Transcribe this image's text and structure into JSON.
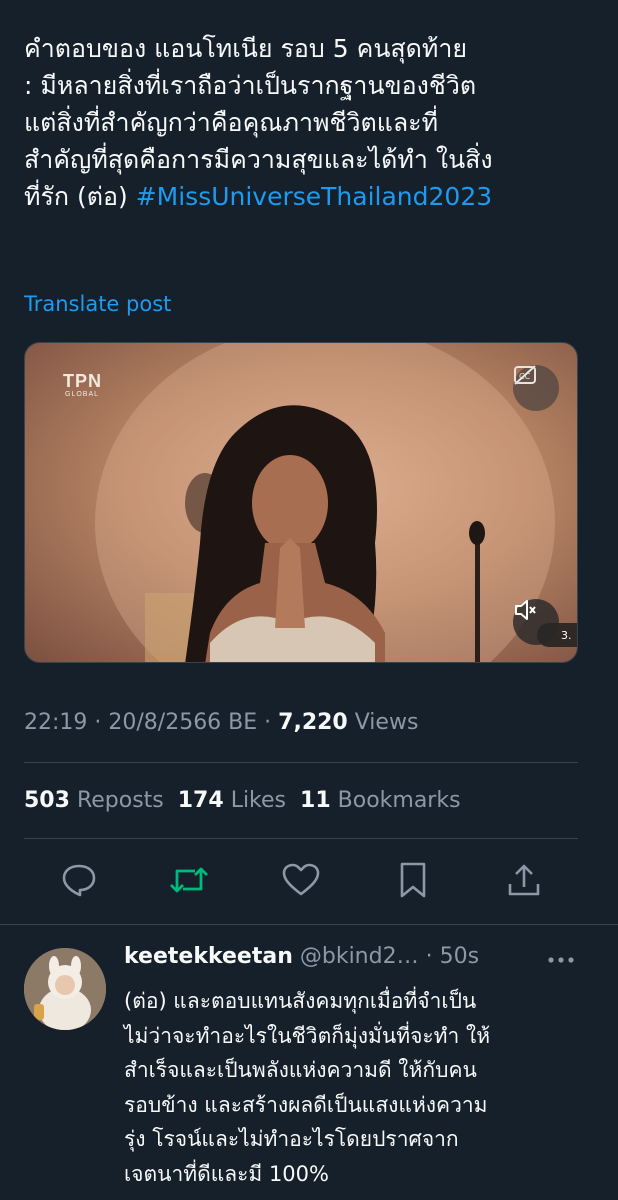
{
  "post": {
    "lines": [
      "คำตอบของ แอนโทเนีย รอบ 5 คนสุดท้าย",
      ": มีหลายสิ่งที่เราถือว่าเป็นรากฐานของชีวิต",
      "แต่สิ่งที่สำคัญกว่าคือคุณภาพชีวิตและที่",
      "สำคัญที่สุดคือการมีความสุขและได้ทำ ในสิ่ง"
    ],
    "last_line_prefix": "ที่รัก (ต่อ) ",
    "hashtag": "#MissUniverseThailand2023",
    "translate_label": "Translate post"
  },
  "media": {
    "logo_text": "TPN",
    "logo_sub": "GLOBAL",
    "icons": [
      "captions-off-icon",
      "mute-icon",
      "viewers-icon"
    ],
    "viewers_count": "3."
  },
  "meta": {
    "timestamp": "22:19 · 20/8/2566 BE · ",
    "views_count": "7,220",
    "views_label": " Views"
  },
  "stats": {
    "reposts_count": "503",
    "reposts_label": "Reposts",
    "likes_count": "174",
    "likes_label": "Likes",
    "bookmarks_count": "11",
    "bookmarks_label": "Bookmarks"
  },
  "actions": {
    "icons": [
      "reply-icon",
      "repost-icon",
      "like-icon",
      "bookmark-icon",
      "share-icon"
    ],
    "repost_color": "#00ba7c"
  },
  "reply": {
    "username": "keetekkeetan",
    "handle": "@bkind2…",
    "time": "· 50s",
    "lines": [
      "(ต่อ) และตอบแทนสังคมทุกเมื่อที่จำเป็น",
      "ไม่ว่าจะทำอะไรในชีวิตก็มุ่งมั่นที่จะทำ ให้",
      "สำเร็จและเป็นพลังแห่งความดี ให้กับคน",
      "รอบข้าง และสร้างผลดีเป็นแสงแห่งความ",
      "รุ่ง โรจน์และไม่ทำอะไรโดยปราศจาก",
      "เจตนาที่ดีและมี 100%"
    ]
  },
  "colors": {
    "background": "#15202b",
    "text": "#f7f9f9",
    "secondary": "#8b98a5",
    "accent": "#1d9bf0",
    "divider": "#38444d"
  }
}
